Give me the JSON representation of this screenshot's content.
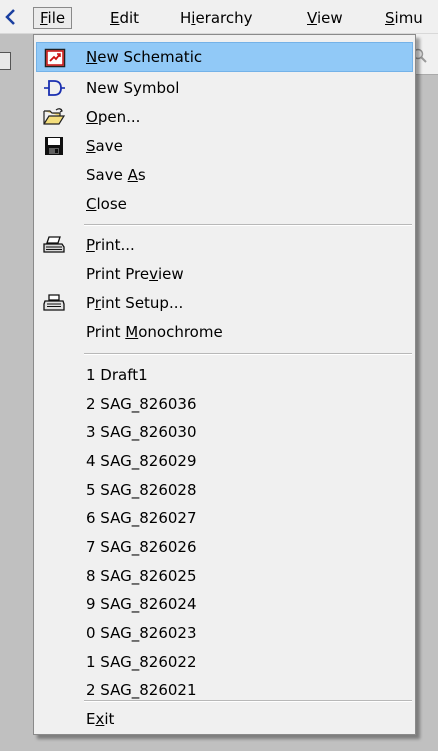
{
  "menubar": {
    "items": [
      {
        "pre": "",
        "key": "F",
        "post": "ile"
      },
      {
        "pre": "",
        "key": "E",
        "post": "dit"
      },
      {
        "pre": "H",
        "key": "i",
        "post": "erarchy"
      },
      {
        "pre": "",
        "key": "V",
        "post": "iew"
      },
      {
        "pre": "",
        "key": "S",
        "post": "imu"
      }
    ]
  },
  "file_menu": {
    "items": [
      {
        "id": "new-schematic",
        "pre": "",
        "key": "N",
        "post": "ew Schematic",
        "icon": "new-schematic-icon",
        "highlighted": true
      },
      {
        "id": "new-symbol",
        "pre": "New Symbol",
        "key": "",
        "post": "",
        "icon": "new-symbol-icon"
      },
      {
        "id": "open",
        "pre": "",
        "key": "O",
        "post": "pen...",
        "icon": "open-folder-icon"
      },
      {
        "id": "save",
        "pre": "",
        "key": "S",
        "post": "ave",
        "icon": "save-icon"
      },
      {
        "id": "save-as",
        "pre": "Save ",
        "key": "A",
        "post": "s",
        "icon": ""
      },
      {
        "id": "close",
        "pre": "",
        "key": "C",
        "post": "lose",
        "icon": ""
      },
      {
        "id": "print",
        "pre": "",
        "key": "P",
        "post": "rint...",
        "icon": "printer-icon"
      },
      {
        "id": "print-preview",
        "pre": "Print Pre",
        "key": "v",
        "post": "iew",
        "icon": ""
      },
      {
        "id": "print-setup",
        "pre": "P",
        "key": "r",
        "post": "int Setup...",
        "icon": "print-setup-icon"
      },
      {
        "id": "print-monochrome",
        "pre": "Print ",
        "key": "M",
        "post": "onochrome",
        "icon": ""
      }
    ],
    "recent_files": [
      "1 Draft1",
      "2 SAG_826036",
      "3 SAG_826030",
      "4 SAG_826029",
      "5 SAG_826028",
      "6 SAG_826027",
      "7 SAG_826026",
      "8 SAG_826025",
      "9 SAG_826024",
      "0 SAG_826023",
      "1 SAG_826022",
      "2 SAG_826021"
    ],
    "exit": {
      "pre": "E",
      "key": "x",
      "post": "it"
    }
  },
  "colors": {
    "highlight": "#91c9f7",
    "menu_bg": "#f0f0f0",
    "desktop_bg": "#c0c0c0"
  }
}
